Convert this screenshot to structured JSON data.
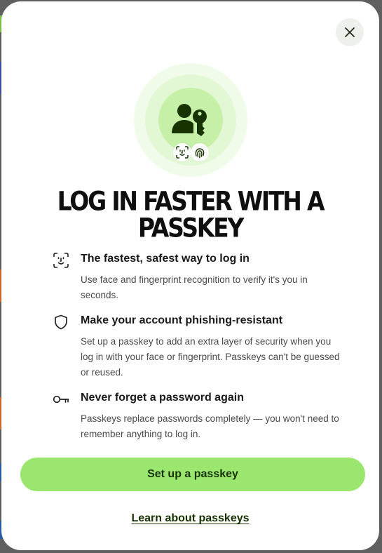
{
  "modal": {
    "close_label": "Close",
    "title": "LOG IN FASTER WITH A PASSKEY"
  },
  "hero": {
    "main_icon": "user-key-icon",
    "badges": [
      "face-id-icon",
      "fingerprint-icon"
    ]
  },
  "features": [
    {
      "icon": "face-scan-icon",
      "title": "The fastest, safest way to log in",
      "description": "Use face and fingerprint recognition to verify it's you in seconds."
    },
    {
      "icon": "shield-icon",
      "title": "Make your account phishing-resistant",
      "description": "Set up a passkey to add an extra layer of security when you log in with your face or fingerprint. Passkeys can't be guessed or reused."
    },
    {
      "icon": "key-icon",
      "title": "Never forget a password again",
      "description": "Passkeys replace passwords completely — you won't need to remember anything to log in."
    }
  ],
  "actions": {
    "primary_label": "Set up a passkey",
    "link_label": "Learn about passkeys"
  },
  "colors": {
    "accent": "#9ae66e",
    "accent_text": "#163300",
    "hero_ring_outer": "#f1fbea",
    "hero_ring_mid": "#e2f8d4",
    "hero_ring_inner": "#c6f0a8"
  }
}
